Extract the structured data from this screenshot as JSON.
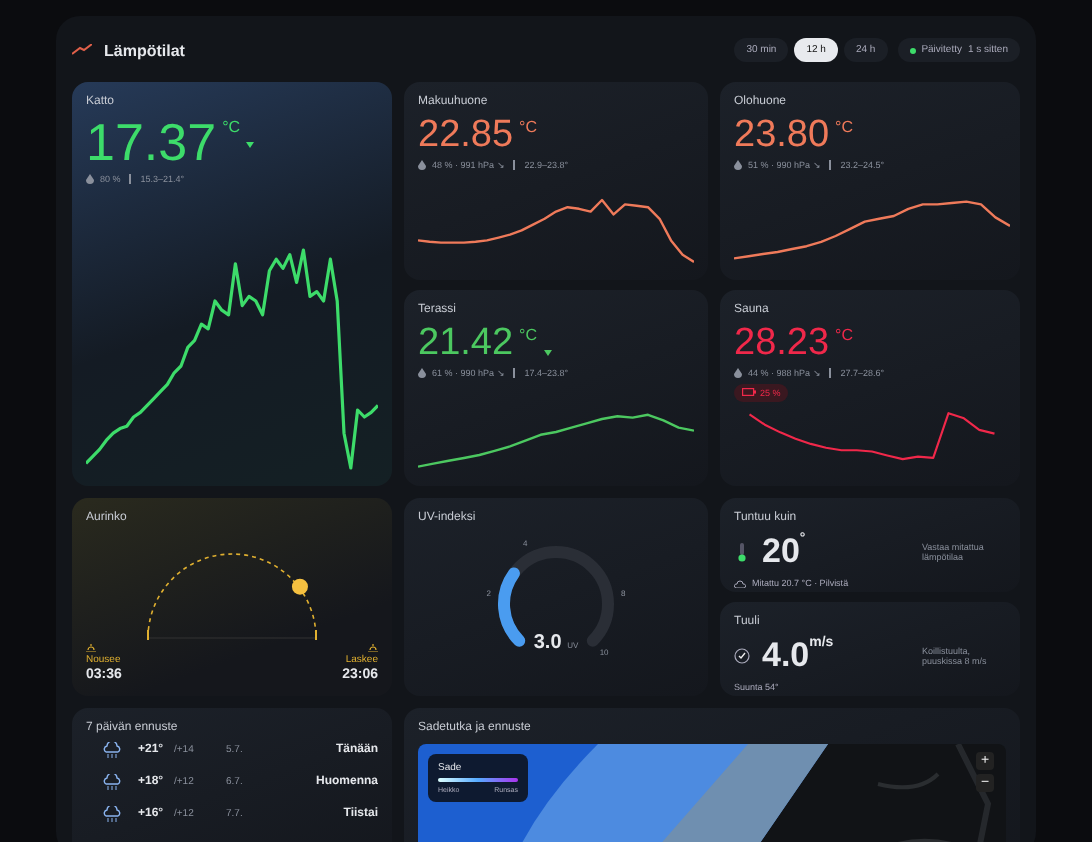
{
  "header": {
    "title": "Lämpötilat",
    "ranges": [
      {
        "label": "30 min",
        "selected": false
      },
      {
        "label": "12 h",
        "selected": true
      },
      {
        "label": "24 h",
        "selected": false
      }
    ],
    "status": {
      "label": "Päivitetty",
      "age": "1 s sitten"
    }
  },
  "sensors": [
    {
      "name": "Katto",
      "value": "17.37",
      "unit": "°C",
      "color": "#3ddc6a",
      "humidity": "80 %",
      "range": "15.3–21.4°",
      "falling": true
    },
    {
      "name": "Makuuhuone",
      "value": "22.85",
      "unit": "°C",
      "color": "#ef7a5a",
      "humidity": "48 % · 991 hPa ↘",
      "range": "22.9–23.8°"
    },
    {
      "name": "Olohuone",
      "value": "23.80",
      "unit": "°C",
      "color": "#ef7a5a",
      "humidity": "51 % · 990 hPa ↘",
      "range": "23.2–24.5°"
    },
    {
      "name": "Terassi",
      "value": "21.42",
      "unit": "°C",
      "color": "#4cc860",
      "humidity": "61 % · 990 hPa ↘",
      "range": "17.4–23.8°",
      "falling": true
    },
    {
      "name": "Sauna",
      "value": "28.23",
      "unit": "°C",
      "color": "#f0284a",
      "humidity": "44 % · 988 hPa ↘",
      "range": "27.7–28.6°",
      "battery": "25 %"
    }
  ],
  "sun": {
    "title": "Aurinko",
    "rise_label": "Nousee",
    "rise": "03:36",
    "set_label": "Laskee",
    "set": "23:06"
  },
  "uv": {
    "title": "UV-indeksi",
    "ticks": [
      "2",
      "4",
      "8",
      "10"
    ],
    "value": "3.0",
    "unit": "UV"
  },
  "feels": {
    "title": "Tuntuu kuin",
    "value": "20",
    "unit": "°",
    "note": "Vastaa mitattua lämpötilaa",
    "detail": "Mitattu 20.7 °C · Pilvistä"
  },
  "wind": {
    "title": "Tuuli",
    "value": "4.0",
    "unit": "m/s",
    "note": "Koillistuulta, puuskissa 8 m/s",
    "direction": "Suunta 54°"
  },
  "forecast": {
    "title": "7 päivän ennuste",
    "days": [
      {
        "high": "+21°",
        "low": "/+14",
        "date": "5.7.",
        "day": "Tänään"
      },
      {
        "high": "+18°",
        "low": "/+12",
        "date": "6.7.",
        "day": "Huomenna"
      },
      {
        "high": "+16°",
        "low": "/+12",
        "date": "7.7.",
        "day": "Tiistai"
      }
    ]
  },
  "radar": {
    "title": "Sadetutka ja ennuste",
    "legend": {
      "title": "Sade",
      "low": "Heikko",
      "high": "Runsas"
    },
    "zoom": [
      "+",
      "−"
    ]
  }
}
